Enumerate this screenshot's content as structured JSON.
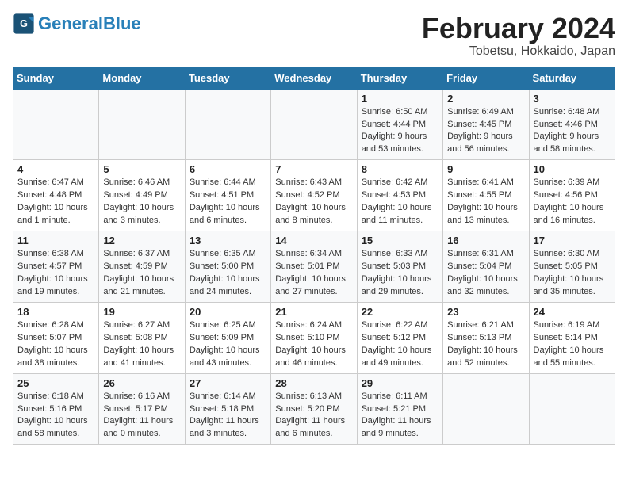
{
  "header": {
    "logo_general": "General",
    "logo_blue": "Blue",
    "month_title": "February 2024",
    "subtitle": "Tobetsu, Hokkaido, Japan"
  },
  "days_of_week": [
    "Sunday",
    "Monday",
    "Tuesday",
    "Wednesday",
    "Thursday",
    "Friday",
    "Saturday"
  ],
  "weeks": [
    [
      {
        "day": "",
        "info": ""
      },
      {
        "day": "",
        "info": ""
      },
      {
        "day": "",
        "info": ""
      },
      {
        "day": "",
        "info": ""
      },
      {
        "day": "1",
        "info": "Sunrise: 6:50 AM\nSunset: 4:44 PM\nDaylight: 9 hours and 53 minutes."
      },
      {
        "day": "2",
        "info": "Sunrise: 6:49 AM\nSunset: 4:45 PM\nDaylight: 9 hours and 56 minutes."
      },
      {
        "day": "3",
        "info": "Sunrise: 6:48 AM\nSunset: 4:46 PM\nDaylight: 9 hours and 58 minutes."
      }
    ],
    [
      {
        "day": "4",
        "info": "Sunrise: 6:47 AM\nSunset: 4:48 PM\nDaylight: 10 hours and 1 minute."
      },
      {
        "day": "5",
        "info": "Sunrise: 6:46 AM\nSunset: 4:49 PM\nDaylight: 10 hours and 3 minutes."
      },
      {
        "day": "6",
        "info": "Sunrise: 6:44 AM\nSunset: 4:51 PM\nDaylight: 10 hours and 6 minutes."
      },
      {
        "day": "7",
        "info": "Sunrise: 6:43 AM\nSunset: 4:52 PM\nDaylight: 10 hours and 8 minutes."
      },
      {
        "day": "8",
        "info": "Sunrise: 6:42 AM\nSunset: 4:53 PM\nDaylight: 10 hours and 11 minutes."
      },
      {
        "day": "9",
        "info": "Sunrise: 6:41 AM\nSunset: 4:55 PM\nDaylight: 10 hours and 13 minutes."
      },
      {
        "day": "10",
        "info": "Sunrise: 6:39 AM\nSunset: 4:56 PM\nDaylight: 10 hours and 16 minutes."
      }
    ],
    [
      {
        "day": "11",
        "info": "Sunrise: 6:38 AM\nSunset: 4:57 PM\nDaylight: 10 hours and 19 minutes."
      },
      {
        "day": "12",
        "info": "Sunrise: 6:37 AM\nSunset: 4:59 PM\nDaylight: 10 hours and 21 minutes."
      },
      {
        "day": "13",
        "info": "Sunrise: 6:35 AM\nSunset: 5:00 PM\nDaylight: 10 hours and 24 minutes."
      },
      {
        "day": "14",
        "info": "Sunrise: 6:34 AM\nSunset: 5:01 PM\nDaylight: 10 hours and 27 minutes."
      },
      {
        "day": "15",
        "info": "Sunrise: 6:33 AM\nSunset: 5:03 PM\nDaylight: 10 hours and 29 minutes."
      },
      {
        "day": "16",
        "info": "Sunrise: 6:31 AM\nSunset: 5:04 PM\nDaylight: 10 hours and 32 minutes."
      },
      {
        "day": "17",
        "info": "Sunrise: 6:30 AM\nSunset: 5:05 PM\nDaylight: 10 hours and 35 minutes."
      }
    ],
    [
      {
        "day": "18",
        "info": "Sunrise: 6:28 AM\nSunset: 5:07 PM\nDaylight: 10 hours and 38 minutes."
      },
      {
        "day": "19",
        "info": "Sunrise: 6:27 AM\nSunset: 5:08 PM\nDaylight: 10 hours and 41 minutes."
      },
      {
        "day": "20",
        "info": "Sunrise: 6:25 AM\nSunset: 5:09 PM\nDaylight: 10 hours and 43 minutes."
      },
      {
        "day": "21",
        "info": "Sunrise: 6:24 AM\nSunset: 5:10 PM\nDaylight: 10 hours and 46 minutes."
      },
      {
        "day": "22",
        "info": "Sunrise: 6:22 AM\nSunset: 5:12 PM\nDaylight: 10 hours and 49 minutes."
      },
      {
        "day": "23",
        "info": "Sunrise: 6:21 AM\nSunset: 5:13 PM\nDaylight: 10 hours and 52 minutes."
      },
      {
        "day": "24",
        "info": "Sunrise: 6:19 AM\nSunset: 5:14 PM\nDaylight: 10 hours and 55 minutes."
      }
    ],
    [
      {
        "day": "25",
        "info": "Sunrise: 6:18 AM\nSunset: 5:16 PM\nDaylight: 10 hours and 58 minutes."
      },
      {
        "day": "26",
        "info": "Sunrise: 6:16 AM\nSunset: 5:17 PM\nDaylight: 11 hours and 0 minutes."
      },
      {
        "day": "27",
        "info": "Sunrise: 6:14 AM\nSunset: 5:18 PM\nDaylight: 11 hours and 3 minutes."
      },
      {
        "day": "28",
        "info": "Sunrise: 6:13 AM\nSunset: 5:20 PM\nDaylight: 11 hours and 6 minutes."
      },
      {
        "day": "29",
        "info": "Sunrise: 6:11 AM\nSunset: 5:21 PM\nDaylight: 11 hours and 9 minutes."
      },
      {
        "day": "",
        "info": ""
      },
      {
        "day": "",
        "info": ""
      }
    ]
  ]
}
